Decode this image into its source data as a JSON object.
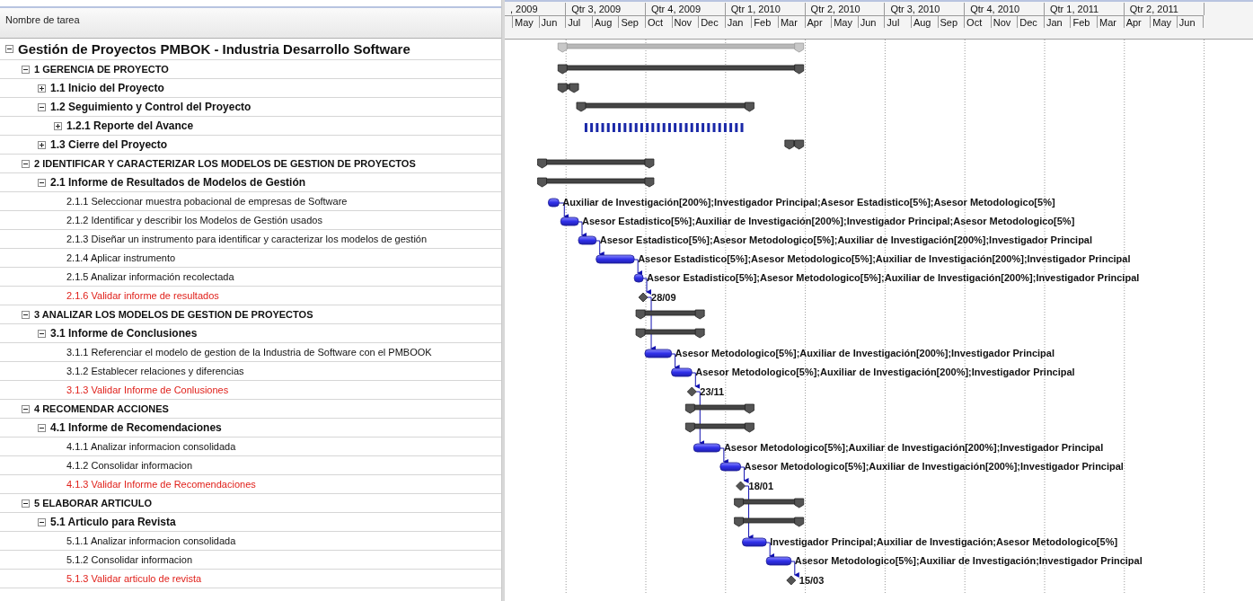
{
  "table": {
    "column_header": "Nombre de tarea"
  },
  "timescale": {
    "quarters": [
      ", 2009",
      "Qtr 3, 2009",
      "Qtr 4, 2009",
      "Qtr 1, 2010",
      "Qtr 2, 2010",
      "Qtr 3, 2010",
      "Qtr 4, 2010",
      "Qtr 1, 2011",
      "Qtr 2, 2011"
    ],
    "months": [
      "May",
      "Jun",
      "Jul",
      "Aug",
      "Sep",
      "Oct",
      "Nov",
      "Dec",
      "Jan",
      "Feb",
      "Mar",
      "Apr",
      "May",
      "Jun",
      "Jul",
      "Aug",
      "Sep",
      "Oct",
      "Nov",
      "Dec",
      "Jan",
      "Feb",
      "Mar",
      "Apr",
      "May",
      "Jun"
    ]
  },
  "project": {
    "name": "Gestión de Proyectos PMBOK - Industria Desarrollo Software",
    "kind": "project",
    "expanded": true,
    "children": [
      {
        "name": "1 GERENCIA DE PROYECTO",
        "kind": "summary",
        "expanded": true,
        "children": [
          {
            "name": "1.1 Inicio del Proyecto",
            "kind": "summary",
            "expanded": false
          },
          {
            "name": "1.2 Seguimiento y Control del Proyecto",
            "kind": "summary",
            "expanded": true,
            "children": [
              {
                "name": "1.2.1 Reporte del Avance",
                "kind": "recurring",
                "expanded": false
              }
            ]
          },
          {
            "name": "1.3 Cierre del Proyecto",
            "kind": "summary",
            "expanded": false
          }
        ]
      },
      {
        "name": "2 IDENTIFICAR Y CARACTERIZAR LOS MODELOS DE GESTION DE PROYECTOS",
        "kind": "summary",
        "expanded": true,
        "children": [
          {
            "name": "2.1 Informe de Resultados de Modelos de Gestión",
            "kind": "summary",
            "expanded": true,
            "children": [
              {
                "name": "2.1.1 Seleccionar muestra pobacional de empresas de Software",
                "kind": "task",
                "resources": "Auxiliar de Investigación[200%];Investigador Principal;Asesor Estadistico[5%];Asesor Metodologico[5%]"
              },
              {
                "name": "2.1.2 Identificar y describir los Modelos de Gestión usados",
                "kind": "task",
                "resources": "Asesor Estadistico[5%];Auxiliar de Investigación[200%];Investigador Principal;Asesor Metodologico[5%]"
              },
              {
                "name": "2.1.3 Diseñar un instrumento para identificar y caracterizar los modelos de gestión",
                "kind": "task",
                "resources": "Asesor Estadistico[5%];Asesor Metodologico[5%];Auxiliar de Investigación[200%];Investigador Principal"
              },
              {
                "name": "2.1.4 Aplicar instrumento",
                "kind": "task",
                "resources": "Asesor Estadistico[5%];Asesor Metodologico[5%];Auxiliar de Investigación[200%];Investigador Principal"
              },
              {
                "name": "2.1.5 Analizar información recolectada",
                "kind": "task",
                "resources": "Asesor Estadistico[5%];Asesor Metodologico[5%];Auxiliar de Investigación[200%];Investigador Principal"
              },
              {
                "name": "2.1.6 Validar informe de resultados",
                "kind": "milestone",
                "date_label": "28/09"
              }
            ]
          }
        ]
      },
      {
        "name": "3 ANALIZAR LOS MODELOS DE GESTION DE PROYECTOS",
        "kind": "summary",
        "expanded": true,
        "children": [
          {
            "name": "3.1 Informe de Conclusiones",
            "kind": "summary",
            "expanded": true,
            "children": [
              {
                "name": "3.1.1 Referenciar el modelo de gestion de la Industria de Software con el PMBOOK",
                "kind": "task",
                "resources": "Asesor Metodologico[5%];Auxiliar de Investigación[200%];Investigador Principal"
              },
              {
                "name": "3.1.2 Establecer relaciones y diferencias",
                "kind": "task",
                "resources": "Asesor Metodologico[5%];Auxiliar de Investigación[200%];Investigador Principal"
              },
              {
                "name": "3.1.3 Validar Informe de Conlusiones",
                "kind": "milestone",
                "date_label": "23/11"
              }
            ]
          }
        ]
      },
      {
        "name": "4 RECOMENDAR ACCIONES",
        "kind": "summary",
        "expanded": true,
        "children": [
          {
            "name": "4.1 Informe de Recomendaciones",
            "kind": "summary",
            "expanded": true,
            "children": [
              {
                "name": "4.1.1 Analizar informacion consolidada",
                "kind": "task",
                "resources": "Asesor Metodologico[5%];Auxiliar de Investigación[200%];Investigador Principal"
              },
              {
                "name": "4.1.2 Consolidar informacion",
                "kind": "task",
                "resources": "Asesor Metodologico[5%];Auxiliar de Investigación[200%];Investigador Principal"
              },
              {
                "name": "4.1.3 Validar Informe de Recomendaciones",
                "kind": "milestone",
                "date_label": "18/01"
              }
            ]
          }
        ]
      },
      {
        "name": "5 ELABORAR ARTICULO",
        "kind": "summary",
        "expanded": true,
        "children": [
          {
            "name": "5.1 Articulo para Revista",
            "kind": "summary",
            "expanded": true,
            "children": [
              {
                "name": "5.1.1 Analizar informacion consolidada",
                "kind": "task",
                "resources": "Investigador Principal;Auxiliar de Investigación;Asesor Metodologico[5%]"
              },
              {
                "name": "5.1.2 Consolidar informacion",
                "kind": "task",
                "resources": "Asesor Metodologico[5%];Auxiliar de Investigación;Investigador Principal"
              },
              {
                "name": "5.1.3 Validar articulo de revista",
                "kind": "milestone",
                "date_label": "15/03"
              }
            ]
          }
        ]
      }
    ]
  }
}
